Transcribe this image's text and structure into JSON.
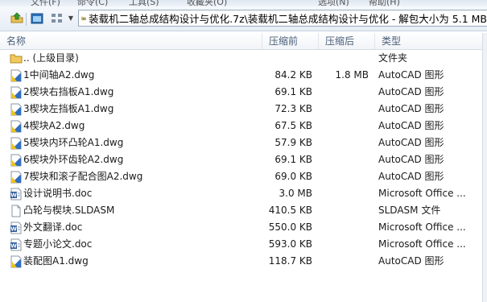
{
  "menu": {
    "items": [
      "文件(F)",
      "命令(C)",
      "工具(S)",
      "收藏夹(O)",
      "选项(N)",
      "帮助(H)"
    ]
  },
  "toolbar": {
    "icons": [
      "up-folder-icon",
      "view-icon",
      "view-options-icon"
    ]
  },
  "address": {
    "path": "装载机二轴总成结构设计与优化.7z\\装载机二轴总成结构设计与优化 - 解包大小为 5.1 MB"
  },
  "columns": {
    "name": "名称",
    "size": "压缩前",
    "packed": "压缩后",
    "type": "类型"
  },
  "files": [
    {
      "icon": "folder-icon",
      "name": ".. (上级目录)",
      "size": "",
      "packed": "",
      "type": "文件夹"
    },
    {
      "icon": "dwg-icon",
      "name": "1中间轴A2.dwg",
      "size": "84.2 KB",
      "packed": "1.8 MB",
      "type": "AutoCAD 图形"
    },
    {
      "icon": "dwg-icon",
      "name": "2楔块右挡板A1.dwg",
      "size": "69.1 KB",
      "packed": "",
      "type": "AutoCAD 图形"
    },
    {
      "icon": "dwg-icon",
      "name": "3楔块左挡板A1.dwg",
      "size": "72.3 KB",
      "packed": "",
      "type": "AutoCAD 图形"
    },
    {
      "icon": "dwg-icon",
      "name": "4楔块A2.dwg",
      "size": "67.5 KB",
      "packed": "",
      "type": "AutoCAD 图形"
    },
    {
      "icon": "dwg-icon",
      "name": "5楔块内环凸轮A1.dwg",
      "size": "57.9 KB",
      "packed": "",
      "type": "AutoCAD 图形"
    },
    {
      "icon": "dwg-icon",
      "name": "6楔块外环齿轮A2.dwg",
      "size": "69.1 KB",
      "packed": "",
      "type": "AutoCAD 图形"
    },
    {
      "icon": "dwg-icon",
      "name": "7楔块和滚子配合图A2.dwg",
      "size": "69.0 KB",
      "packed": "",
      "type": "AutoCAD 图形"
    },
    {
      "icon": "doc-icon",
      "name": "设计说明书.doc",
      "size": "3.0 MB",
      "packed": "",
      "type": "Microsoft Office ..."
    },
    {
      "icon": "blank-file-icon",
      "name": "凸轮与楔块.SLDASM",
      "size": "410.5 KB",
      "packed": "",
      "type": "SLDASM 文件"
    },
    {
      "icon": "doc-icon",
      "name": "外文翻译.doc",
      "size": "550.0 KB",
      "packed": "",
      "type": "Microsoft Office ..."
    },
    {
      "icon": "doc-icon",
      "name": "专题小论文.doc",
      "size": "593.0 KB",
      "packed": "",
      "type": "Microsoft Office ..."
    },
    {
      "icon": "dwg-icon",
      "name": "装配图A1.dwg",
      "size": "118.7 KB",
      "packed": "",
      "type": "AutoCAD 图形"
    }
  ]
}
